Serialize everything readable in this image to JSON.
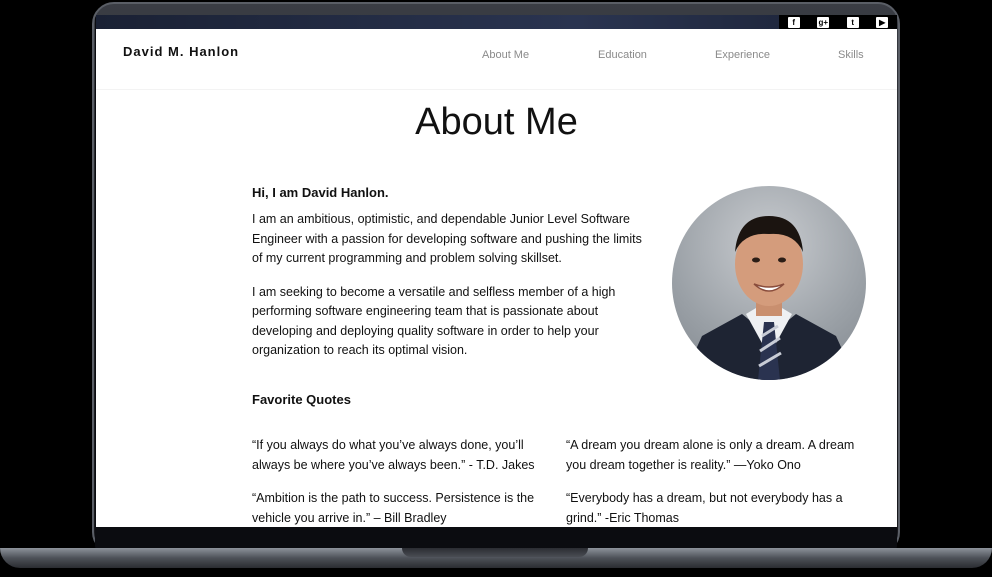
{
  "site": {
    "brand": "David M. Hanlon",
    "nav": [
      "About Me",
      "Education",
      "Experience",
      "Skills"
    ],
    "social_icons": [
      "facebook-icon",
      "google-plus-icon",
      "twitter-icon",
      "youtube-icon"
    ]
  },
  "about": {
    "title": "About Me",
    "greeting": "Hi, I am David Hanlon.",
    "paragraphs": [
      "I am an ambitious, optimistic, and dependable Junior Level Software Engineer with a passion for developing software and pushing the limits of my current programming and problem solving skillset.",
      "I am seeking to become a versatile and selfless member of a high performing software engineering team that is passionate about developing and deploying quality software in order to help your organization to reach its optimal vision."
    ]
  },
  "quotes": {
    "heading": "Favorite Quotes",
    "items": [
      "“If you always do what you’ve always done, you’ll always be where you’ve always been.” - T.D. Jakes",
      "“A dream you dream alone is only a dream. A dream you dream together is reality.” —Yoko Ono",
      "“Ambition is the path to success. Persistence is the vehicle you arrive in.” – Bill Bradley",
      "“Everybody has a dream, but not everybody has a grind.” -Eric Thomas"
    ]
  }
}
